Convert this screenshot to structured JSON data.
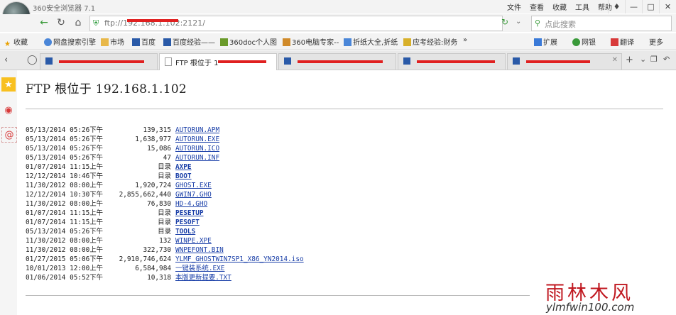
{
  "window": {
    "app_title": "360安全浏览器 7.1",
    "menu": [
      "文件",
      "查看",
      "收藏",
      "工具",
      "帮助"
    ]
  },
  "address_bar": {
    "url_prefix": "ftp://",
    "url_suffix": ":2121/",
    "url_visible": "192.168.1.102"
  },
  "search": {
    "placeholder": "点此搜索"
  },
  "bookmarks": {
    "items": [
      "收藏",
      "网盘搜索引擎",
      "市场",
      "百度",
      "百度经验——",
      "360doc个人图",
      "360电脑专家--",
      "折纸大全,折纸",
      "应考经验:财务"
    ],
    "more": "»",
    "right_tools": [
      "扩展",
      "网银",
      "翻译",
      "更多"
    ]
  },
  "tabs": {
    "active_label": "FTP 根位于 1"
  },
  "page": {
    "title": "FTP 根位于 192.168.1.102",
    "dir_label": "目录",
    "files": [
      {
        "date": "05/13/2014 05:26下午",
        "size": "139,315",
        "name": "AUTORUN.APM",
        "dir": false
      },
      {
        "date": "05/13/2014 05:26下午",
        "size": "1,638,977",
        "name": "AUTORUN.EXE",
        "dir": false
      },
      {
        "date": "05/13/2014 05:26下午",
        "size": "15,086",
        "name": "AUTORUN.ICO",
        "dir": false
      },
      {
        "date": "05/13/2014 05:26下午",
        "size": "47",
        "name": "AUTORUN.INF",
        "dir": false
      },
      {
        "date": "01/07/2014 11:15上午",
        "size": "",
        "name": "AXPE",
        "dir": true
      },
      {
        "date": "12/12/2014 10:46下午",
        "size": "",
        "name": "BOOT",
        "dir": true
      },
      {
        "date": "11/30/2012 08:00上午",
        "size": "1,920,724",
        "name": "GHOST.EXE",
        "dir": false
      },
      {
        "date": "12/12/2014 10:30下午",
        "size": "2,855,662,440",
        "name": "GWIN7.GHO",
        "dir": false
      },
      {
        "date": "11/30/2012 08:00上午",
        "size": "76,830",
        "name": "HD-4.GHO",
        "dir": false
      },
      {
        "date": "01/07/2014 11:15上午",
        "size": "",
        "name": "PESETUP",
        "dir": true
      },
      {
        "date": "01/07/2014 11:15上午",
        "size": "",
        "name": "PESOFT",
        "dir": true
      },
      {
        "date": "05/13/2014 05:26下午",
        "size": "",
        "name": "TOOLS",
        "dir": true
      },
      {
        "date": "11/30/2012 08:00上午",
        "size": "132",
        "name": "WINPE.XPE",
        "dir": false
      },
      {
        "date": "11/30/2012 08:00上午",
        "size": "322,730",
        "name": "WNPEFONT.BIN",
        "dir": false
      },
      {
        "date": "01/27/2015 05:06下午",
        "size": "2,910,746,624",
        "name": "YLMF_GHOSTWIN7SP1_X86_YN2014.iso",
        "dir": false
      },
      {
        "date": "10/01/2013 12:00上午",
        "size": "6,584,984",
        "name": "一键装系统.EXE",
        "dir": false
      },
      {
        "date": "01/06/2014 05:52下午",
        "size": "10,318",
        "name": "本版更新提要.TXT",
        "dir": false
      }
    ]
  },
  "watermark": {
    "line1": "雨林木风",
    "line2": "ylmfwin100.com"
  },
  "colors": {
    "link": "#1a3fa8",
    "redaction": "#e02020",
    "accent_green": "#2a9a3a"
  }
}
